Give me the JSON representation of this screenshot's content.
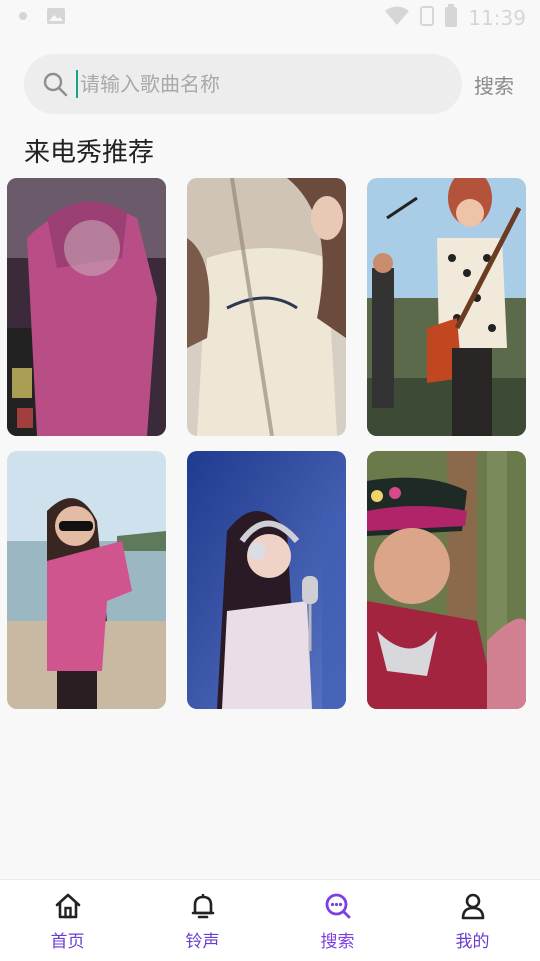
{
  "status_bar": {
    "time": "11:39",
    "left_icons": [
      "notification-icon",
      "image-icon"
    ],
    "right_icons": [
      "wifi-icon",
      "sim-icon",
      "battery-icon"
    ]
  },
  "search": {
    "placeholder": "请输入歌曲名称",
    "value": "",
    "button_label": "搜索"
  },
  "section": {
    "title": "来电秀推荐"
  },
  "cards": [
    {
      "name": "video-thumbnail-1",
      "desc_icon": "pink-outfit-thumbnail"
    },
    {
      "name": "video-thumbnail-2",
      "desc_icon": "white-top-thumbnail"
    },
    {
      "name": "video-thumbnail-3",
      "desc_icon": "guitarist-thumbnail"
    },
    {
      "name": "video-thumbnail-4",
      "desc_icon": "beach-thumbnail"
    },
    {
      "name": "video-thumbnail-5",
      "desc_icon": "singer-microphone-thumbnail"
    },
    {
      "name": "video-thumbnail-6",
      "desc_icon": "traditional-costume-thumbnail"
    }
  ],
  "tabbar": {
    "items": [
      {
        "label": "首页",
        "icon": "home-icon",
        "active": false
      },
      {
        "label": "铃声",
        "icon": "bell-icon",
        "active": false
      },
      {
        "label": "搜索",
        "icon": "search-icon",
        "active": true
      },
      {
        "label": "我的",
        "icon": "user-icon",
        "active": false
      }
    ]
  },
  "colors": {
    "accent": "#7b3fe4",
    "tab_label": "#6a3fd0",
    "background": "#f8f8f9",
    "search_bg": "#ededee"
  }
}
